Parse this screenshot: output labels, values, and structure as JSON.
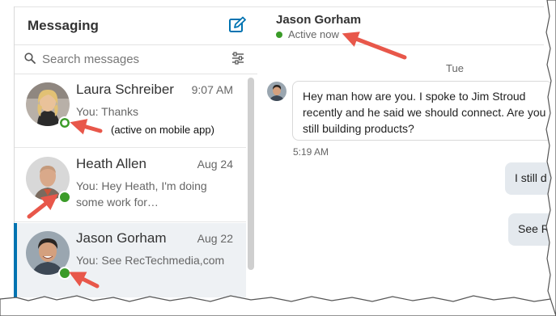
{
  "sidebar": {
    "title": "Messaging",
    "compose_icon": "compose-icon",
    "search": {
      "placeholder": "Search messages",
      "value": ""
    },
    "conversations": [
      {
        "name": "Laura Schreiber",
        "time": "9:07 AM",
        "snippet": "You: Thanks",
        "presence": "mobile",
        "avatar": "woman-portrait"
      },
      {
        "name": "Heath Allen",
        "time": "Aug 24",
        "snippet": "You: Hey Heath, I'm doing some work for…",
        "presence": "active",
        "avatar": "man-portrait"
      },
      {
        "name": "Jason Gorham",
        "time": "Aug 22",
        "snippet": "You: See RecTechmedia,com",
        "presence": "active",
        "avatar": "man-portrait",
        "selected": true
      }
    ]
  },
  "annotation": "(active on mobile app)",
  "chat": {
    "contact_name": "Jason Gorham",
    "status": "Active now",
    "day_label": "Tue",
    "incoming_lines": [
      "Hey man how are you. I spoke to Jim Stroud",
      "recently and he said we should connect. Are you",
      "still building products?"
    ],
    "incoming_time": "5:19 AM",
    "outgoing": [
      "I still d",
      "See R"
    ]
  },
  "colors": {
    "accent": "#0073b1",
    "presence_green": "#3a9b28",
    "arrow_red": "#e8574a",
    "selected_bg": "#eef1f4",
    "outgoing_bubble": "#e4e9ee"
  }
}
